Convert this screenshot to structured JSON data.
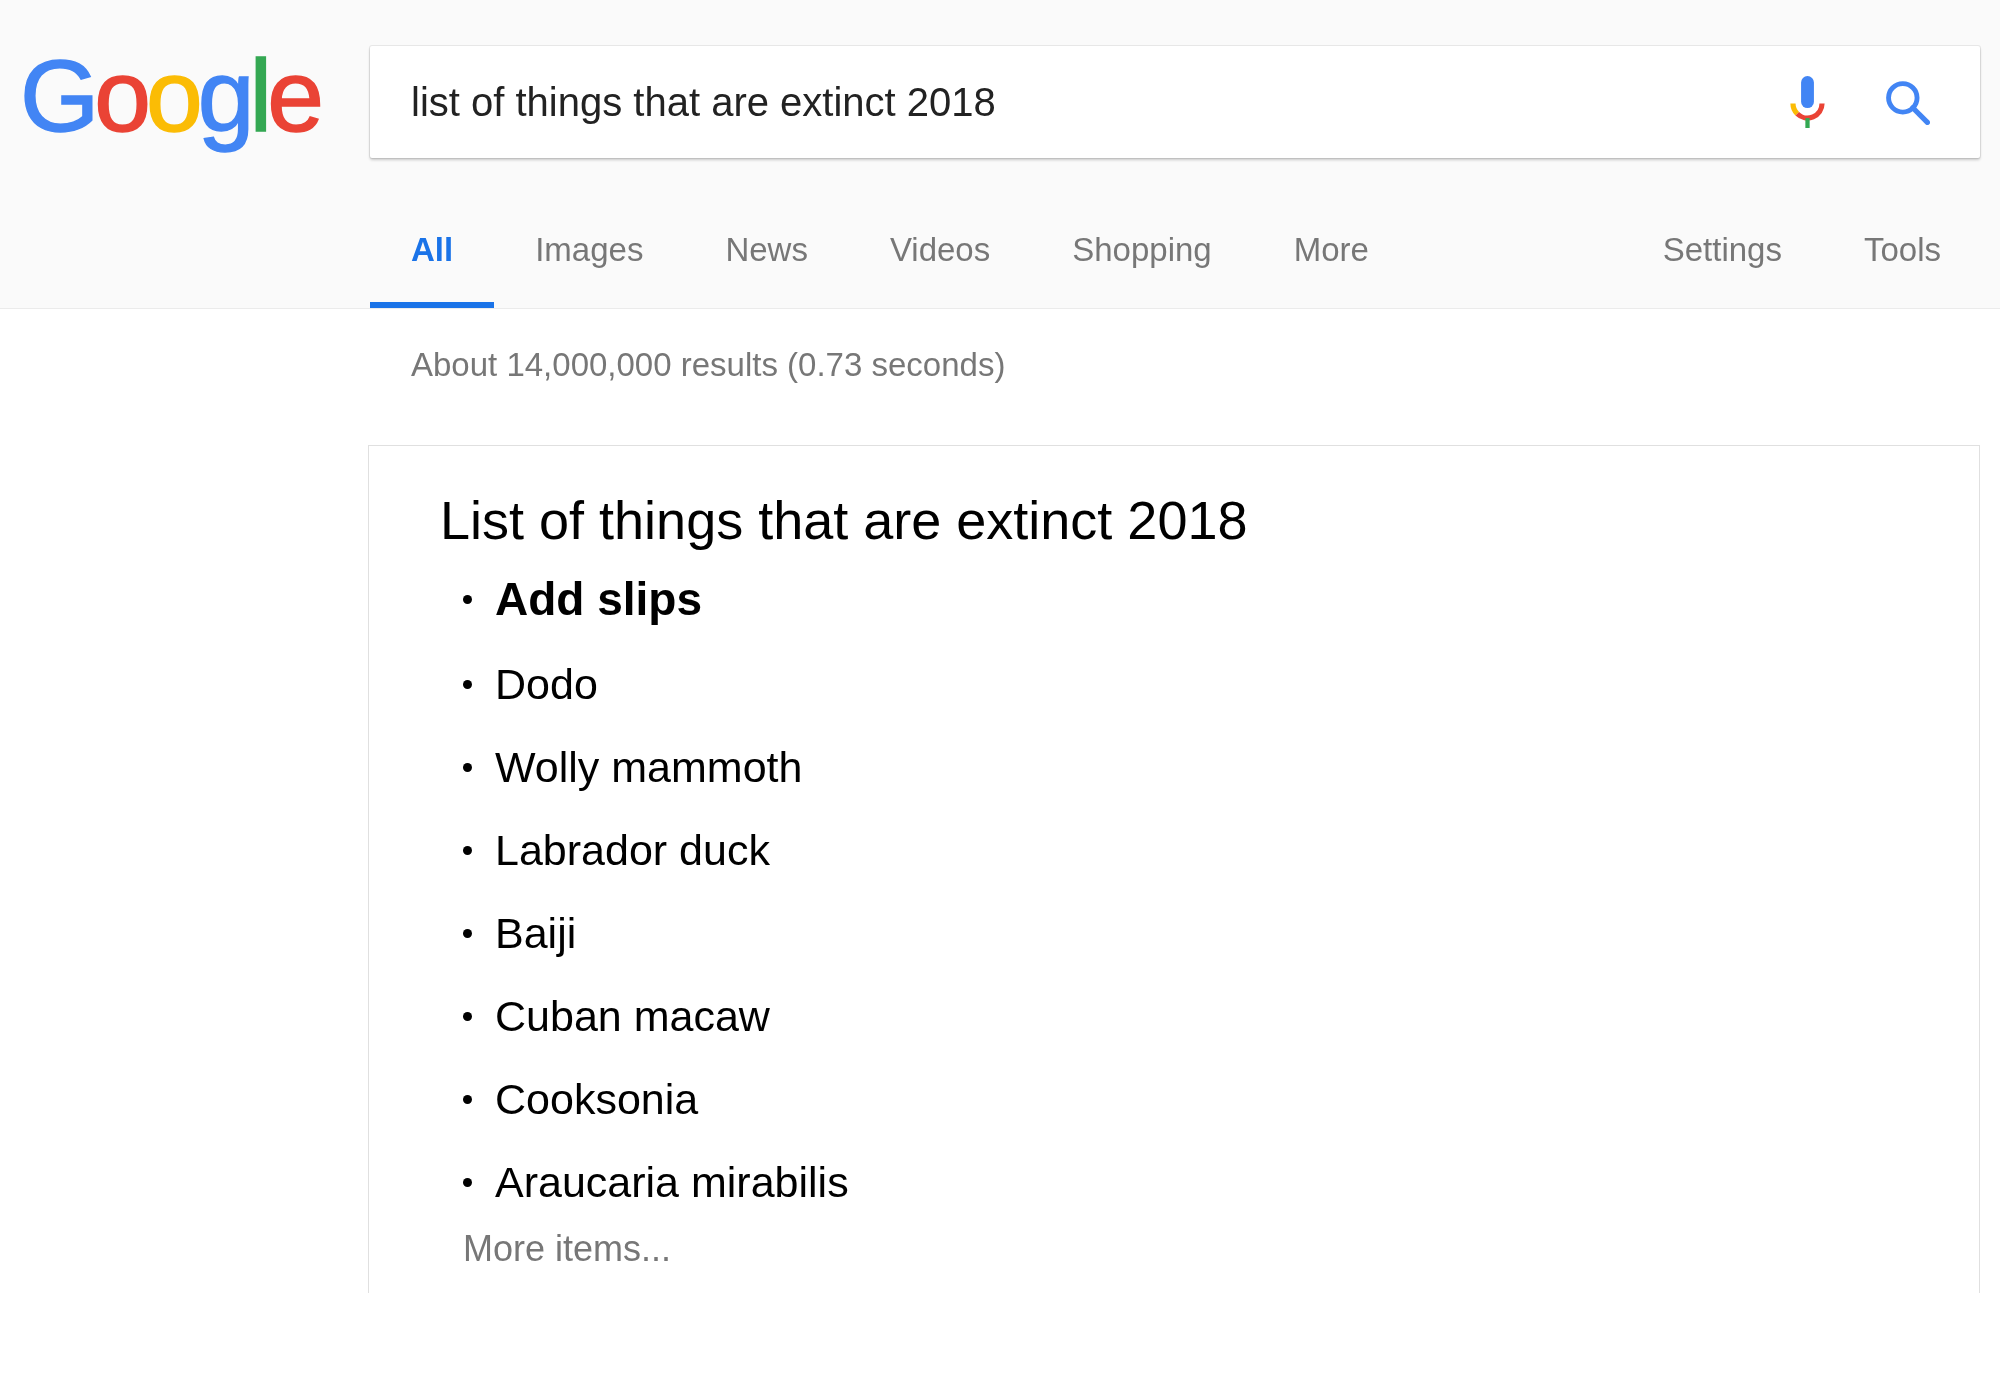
{
  "logo": "Google",
  "search": {
    "value": "list of things that are extinct 2018"
  },
  "tabs": [
    {
      "label": "All",
      "selected": true
    },
    {
      "label": "Images",
      "selected": false
    },
    {
      "label": "News",
      "selected": false
    },
    {
      "label": "Videos",
      "selected": false
    },
    {
      "label": "Shopping",
      "selected": false
    },
    {
      "label": "More",
      "selected": false
    }
  ],
  "tools": [
    "Settings",
    "Tools"
  ],
  "result_stats": "About 14,000,000 results (0.73 seconds)",
  "featured_snippet": {
    "title": "List of things that are extinct 2018",
    "items": [
      {
        "text": "Add slips",
        "kind": "heading"
      },
      {
        "text": "Dodo",
        "kind": "item"
      },
      {
        "text": "Wolly mammoth",
        "kind": "item"
      },
      {
        "text": "Labrador duck",
        "kind": "item"
      },
      {
        "text": "Baiji",
        "kind": "item"
      },
      {
        "text": "Cuban macaw",
        "kind": "item"
      },
      {
        "text": "Cooksonia",
        "kind": "item"
      },
      {
        "text": "Araucaria mirabilis",
        "kind": "item"
      }
    ],
    "more_link": "More items..."
  }
}
